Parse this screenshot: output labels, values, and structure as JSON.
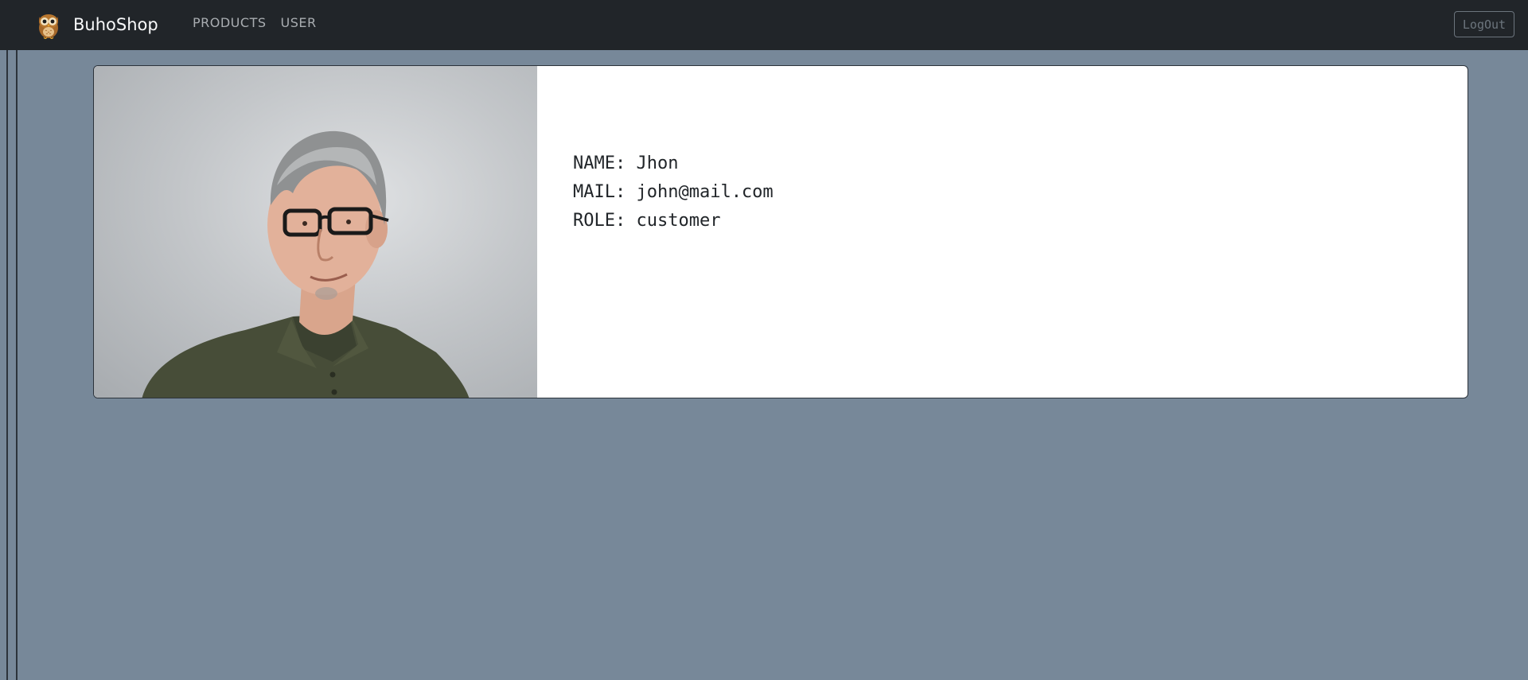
{
  "navbar": {
    "brand": "BuhoShop",
    "logo_icon": "owl-icon",
    "links": [
      "PRODUCTS",
      "USER"
    ],
    "logout_label": "LogOut"
  },
  "profile": {
    "photo": "user-portrait-photo",
    "name_label": "NAME:",
    "name_value": "Jhon",
    "mail_label": "MAIL:",
    "mail_value": "john@mail.com",
    "role_label": "ROLE:",
    "role_value": "customer"
  },
  "colors": {
    "page_bg": "#778899",
    "navbar_bg": "#212529",
    "card_bg": "#ffffff"
  }
}
